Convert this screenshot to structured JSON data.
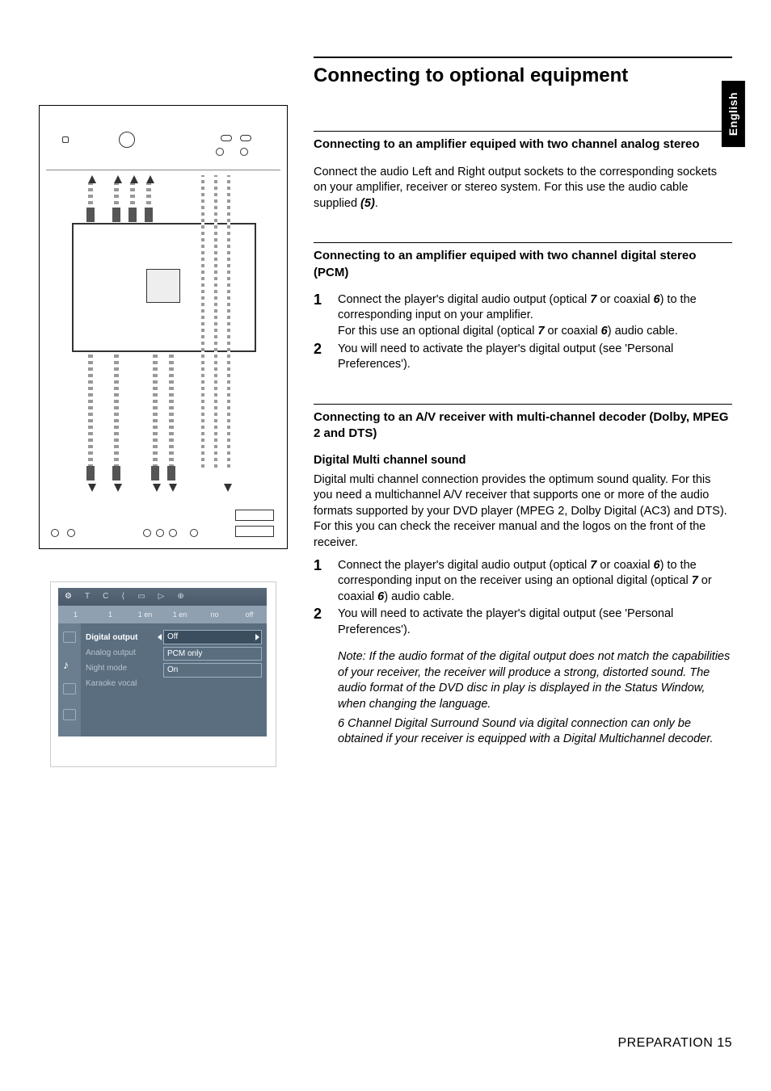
{
  "lang_tab": "English",
  "main_title": "Connecting to optional equipment",
  "section1": {
    "title": "Connecting to an amplifier equiped with two channel analog stereo",
    "p1_a": "Connect the audio Left and Right output sockets to the corresponding sockets on your amplifier, receiver or stereo system. For this use the audio cable supplied ",
    "p1_ref": "(5)",
    "p1_b": "."
  },
  "section2": {
    "title": "Connecting to an amplifier equiped with two channel digital stereo (PCM)",
    "step1_a": "Connect the player's digital audio output (optical ",
    "step1_r1": "7",
    "step1_b": " or coaxial ",
    "step1_r2": "6",
    "step1_c": ") to the corresponding input on your amplifier.",
    "step1_d_a": "For this use an optional digital (optical ",
    "step1_d_r1": "7",
    "step1_d_b": " or coaxial ",
    "step1_d_r2": "6",
    "step1_d_c": ") audio cable.",
    "step2": "You will need to activate the player's digital output (see 'Personal Preferences')."
  },
  "section3": {
    "title": "Connecting to an A/V receiver with multi-channel decoder (Dolby, MPEG 2 and DTS)",
    "subhead": "Digital Multi channel sound",
    "intro": "Digital multi channel connection provides the optimum sound quality. For this you need a multichannel A/V receiver that supports one or more of the audio formats supported by your DVD player (MPEG 2, Dolby Digital (AC3) and DTS). For this you can check the receiver manual and the logos on the front of the receiver.",
    "step1_a": "Connect the player's digital audio output (optical ",
    "step1_r1": "7",
    "step1_b": " or coaxial ",
    "step1_r2": "6",
    "step1_c": ") to the corresponding input on the receiver using an optional digital (optical ",
    "step1_r3": "7",
    "step1_d": " or coaxial ",
    "step1_r4": "6",
    "step1_e": ") audio cable.",
    "step2": "You will need to activate the player's digital output (see 'Personal Preferences').",
    "note1": "Note:  If the audio format of the digital output does not match the capabilities of your receiver, the receiver will produce a strong, distorted sound. The audio format of the DVD disc in play is displayed in the Status Window, when changing the language.",
    "note2": "6 Channel Digital Surround Sound via digital connection can only be obtained if your receiver is equipped with a Digital Multichannel decoder."
  },
  "osd": {
    "top_icons": [
      "⚙",
      "T",
      "C",
      "⟨",
      "▭",
      "▷",
      "⊕"
    ],
    "mid": [
      "1",
      "1",
      "1 en",
      "1 en",
      "no",
      "off"
    ],
    "left": {
      "i1": "Digital output",
      "i2": "Analog output",
      "i3": "Night mode",
      "i4": "Karaoke vocal"
    },
    "opts": {
      "o1": "Off",
      "o2": "PCM only",
      "o3": "On"
    }
  },
  "footer": "PREPARATION 15"
}
